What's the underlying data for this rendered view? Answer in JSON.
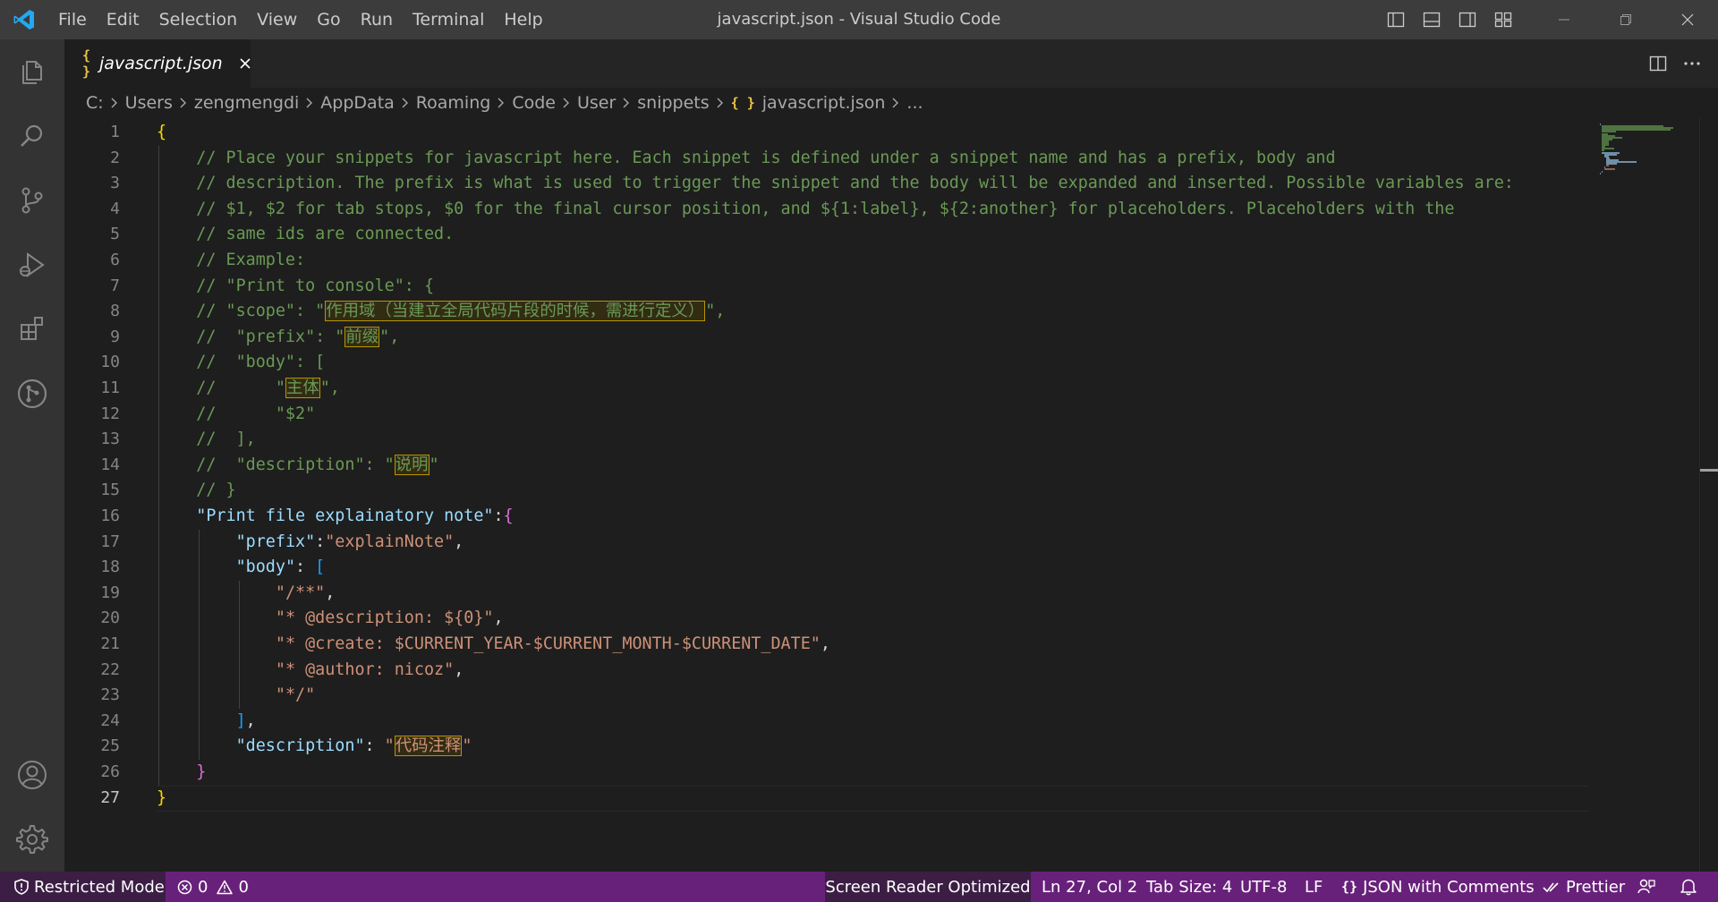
{
  "titlebar": {
    "menu": [
      "File",
      "Edit",
      "Selection",
      "View",
      "Go",
      "Run",
      "Terminal",
      "Help"
    ],
    "window_title": "javascript.json - Visual Studio Code"
  },
  "tab": {
    "label": "javascript.json"
  },
  "breadcrumb": {
    "items": [
      "C:",
      "Users",
      "zengmengdi",
      "AppData",
      "Roaming",
      "Code",
      "User",
      "snippets"
    ],
    "file": "javascript.json",
    "more": "..."
  },
  "editor": {
    "cursor_line": 27,
    "lines": [
      [
        [
          "b1",
          "{"
        ]
      ],
      [
        [
          "c",
          "    // Place your snippets for javascript here. Each snippet is defined under a snippet name and has a prefix, body and"
        ]
      ],
      [
        [
          "c",
          "    // description. The prefix is what is used to trigger the snippet and the body will be expanded and inserted. Possible variables are:"
        ]
      ],
      [
        [
          "c",
          "    // $1, $2 for tab stops, $0 for the final cursor position, and ${1:label}, ${2:another} for placeholders. Placeholders with the"
        ]
      ],
      [
        [
          "c",
          "    // same ids are connected."
        ]
      ],
      [
        [
          "c",
          "    // Example:"
        ]
      ],
      [
        [
          "c",
          "    // \"Print to console\": {"
        ]
      ],
      [
        [
          "c",
          "    // \"scope\": \""
        ],
        [
          "c hl",
          "作用域（当建立全局代码片段的时候，需进行定义）"
        ],
        [
          "c",
          "\","
        ]
      ],
      [
        [
          "c",
          "    //  \"prefix\": \""
        ],
        [
          "c hl",
          "前缀"
        ],
        [
          "c",
          "\","
        ]
      ],
      [
        [
          "c",
          "    //  \"body\": ["
        ]
      ],
      [
        [
          "c",
          "    //      \""
        ],
        [
          "c hl",
          "主体"
        ],
        [
          "c",
          "\","
        ]
      ],
      [
        [
          "c",
          "    //      \"$2\""
        ]
      ],
      [
        [
          "c",
          "    //  ],"
        ]
      ],
      [
        [
          "c",
          "    //  \"description\": \""
        ],
        [
          "c hl",
          "说明"
        ],
        [
          "c",
          "\""
        ]
      ],
      [
        [
          "c",
          "    // }"
        ]
      ],
      [
        [
          "p",
          "    "
        ],
        [
          "k",
          "\"Print file explainatory note\""
        ],
        [
          "p",
          ":"
        ],
        [
          "b2",
          "{"
        ]
      ],
      [
        [
          "p",
          "        "
        ],
        [
          "k",
          "\"prefix\""
        ],
        [
          "p",
          ":"
        ],
        [
          "s",
          "\"explainNote\""
        ],
        [
          "p",
          ","
        ]
      ],
      [
        [
          "p",
          "        "
        ],
        [
          "k",
          "\"body\""
        ],
        [
          "p",
          ": "
        ],
        [
          "b3",
          "["
        ]
      ],
      [
        [
          "p",
          "            "
        ],
        [
          "s",
          "\"/**\""
        ],
        [
          "p",
          ","
        ]
      ],
      [
        [
          "p",
          "            "
        ],
        [
          "s",
          "\"* @description: ${0}\""
        ],
        [
          "p",
          ","
        ]
      ],
      [
        [
          "p",
          "            "
        ],
        [
          "s",
          "\"* @create: $CURRENT_YEAR-$CURRENT_MONTH-$CURRENT_DATE\""
        ],
        [
          "p",
          ","
        ]
      ],
      [
        [
          "p",
          "            "
        ],
        [
          "s",
          "\"* @author: nicoz\""
        ],
        [
          "p",
          ","
        ]
      ],
      [
        [
          "p",
          "            "
        ],
        [
          "s",
          "\"*/\""
        ]
      ],
      [
        [
          "p",
          "        "
        ],
        [
          "b3",
          "]"
        ],
        [
          "p",
          ","
        ]
      ],
      [
        [
          "p",
          "        "
        ],
        [
          "k",
          "\"description\""
        ],
        [
          "p",
          ": "
        ],
        [
          "s",
          "\""
        ],
        [
          "s hl",
          "代码注释"
        ],
        [
          "s",
          "\""
        ]
      ],
      [
        [
          "p",
          "    "
        ],
        [
          "b2",
          "}"
        ]
      ],
      [
        [
          "b1",
          "}"
        ]
      ]
    ]
  },
  "statusbar": {
    "restricted_mode": "Restricted Mode",
    "errors": "0",
    "warnings": "0",
    "screen_reader": "Screen Reader Optimized",
    "position": "Ln 27, Col 2",
    "tab_size": "Tab Size: 4",
    "encoding": "UTF-8",
    "eol": "LF",
    "language": "JSON with Comments",
    "prettier": "Prettier"
  },
  "colors": {
    "statusbar": "#68217a",
    "titlebar": "#3c3c3c",
    "activitybar": "#333333",
    "editor_bg": "#1e1e1e",
    "comment": "#6a9955",
    "string": "#ce9178",
    "key": "#9cdcfe"
  }
}
